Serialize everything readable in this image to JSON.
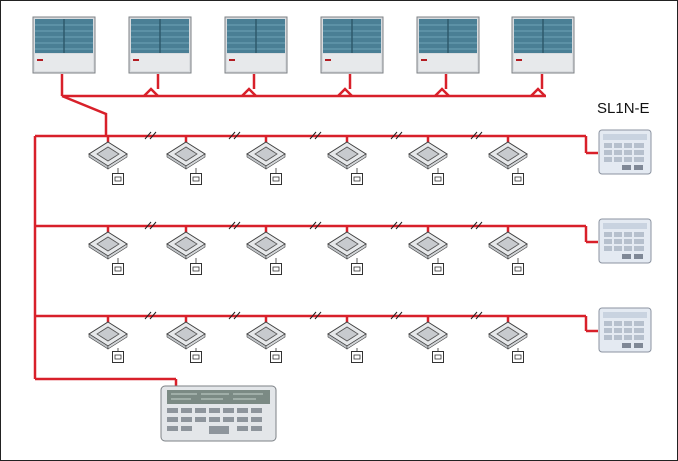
{
  "diagram": {
    "header_fragment": "",
    "remote_controller_label": "SL1N-E",
    "outdoor_unit_count": 6,
    "indoor_rows": 3,
    "indoor_units_per_row": 6,
    "colors": {
      "refrigerant_pipe": "#d8202a",
      "outline": "#333333",
      "outdoor_panel": "#4a7f95",
      "outdoor_body": "#d9dcdf"
    }
  }
}
